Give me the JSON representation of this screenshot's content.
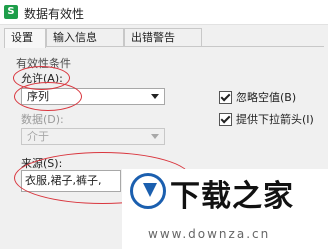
{
  "window": {
    "title": "数据有效性",
    "app_icon": "S"
  },
  "tabs": [
    {
      "label": "设置"
    },
    {
      "label": "输入信息"
    },
    {
      "label": "出错警告"
    }
  ],
  "settings": {
    "section_title": "有效性条件",
    "allow_label": "允许(A):",
    "allow_value": "序列",
    "data_label": "数据(D):",
    "data_value": "介于",
    "ignore_blank_label": "忽略空值(B)",
    "ignore_blank_checked": true,
    "dropdown_label": "提供下拉箭头(I)",
    "dropdown_checked": true,
    "source_label": "来源(S):",
    "source_value": "衣服,裙子,裤子,"
  },
  "highlight_color": "#d9363e",
  "watermark": {
    "title": "下载之家",
    "url": "www.downza.cn"
  }
}
